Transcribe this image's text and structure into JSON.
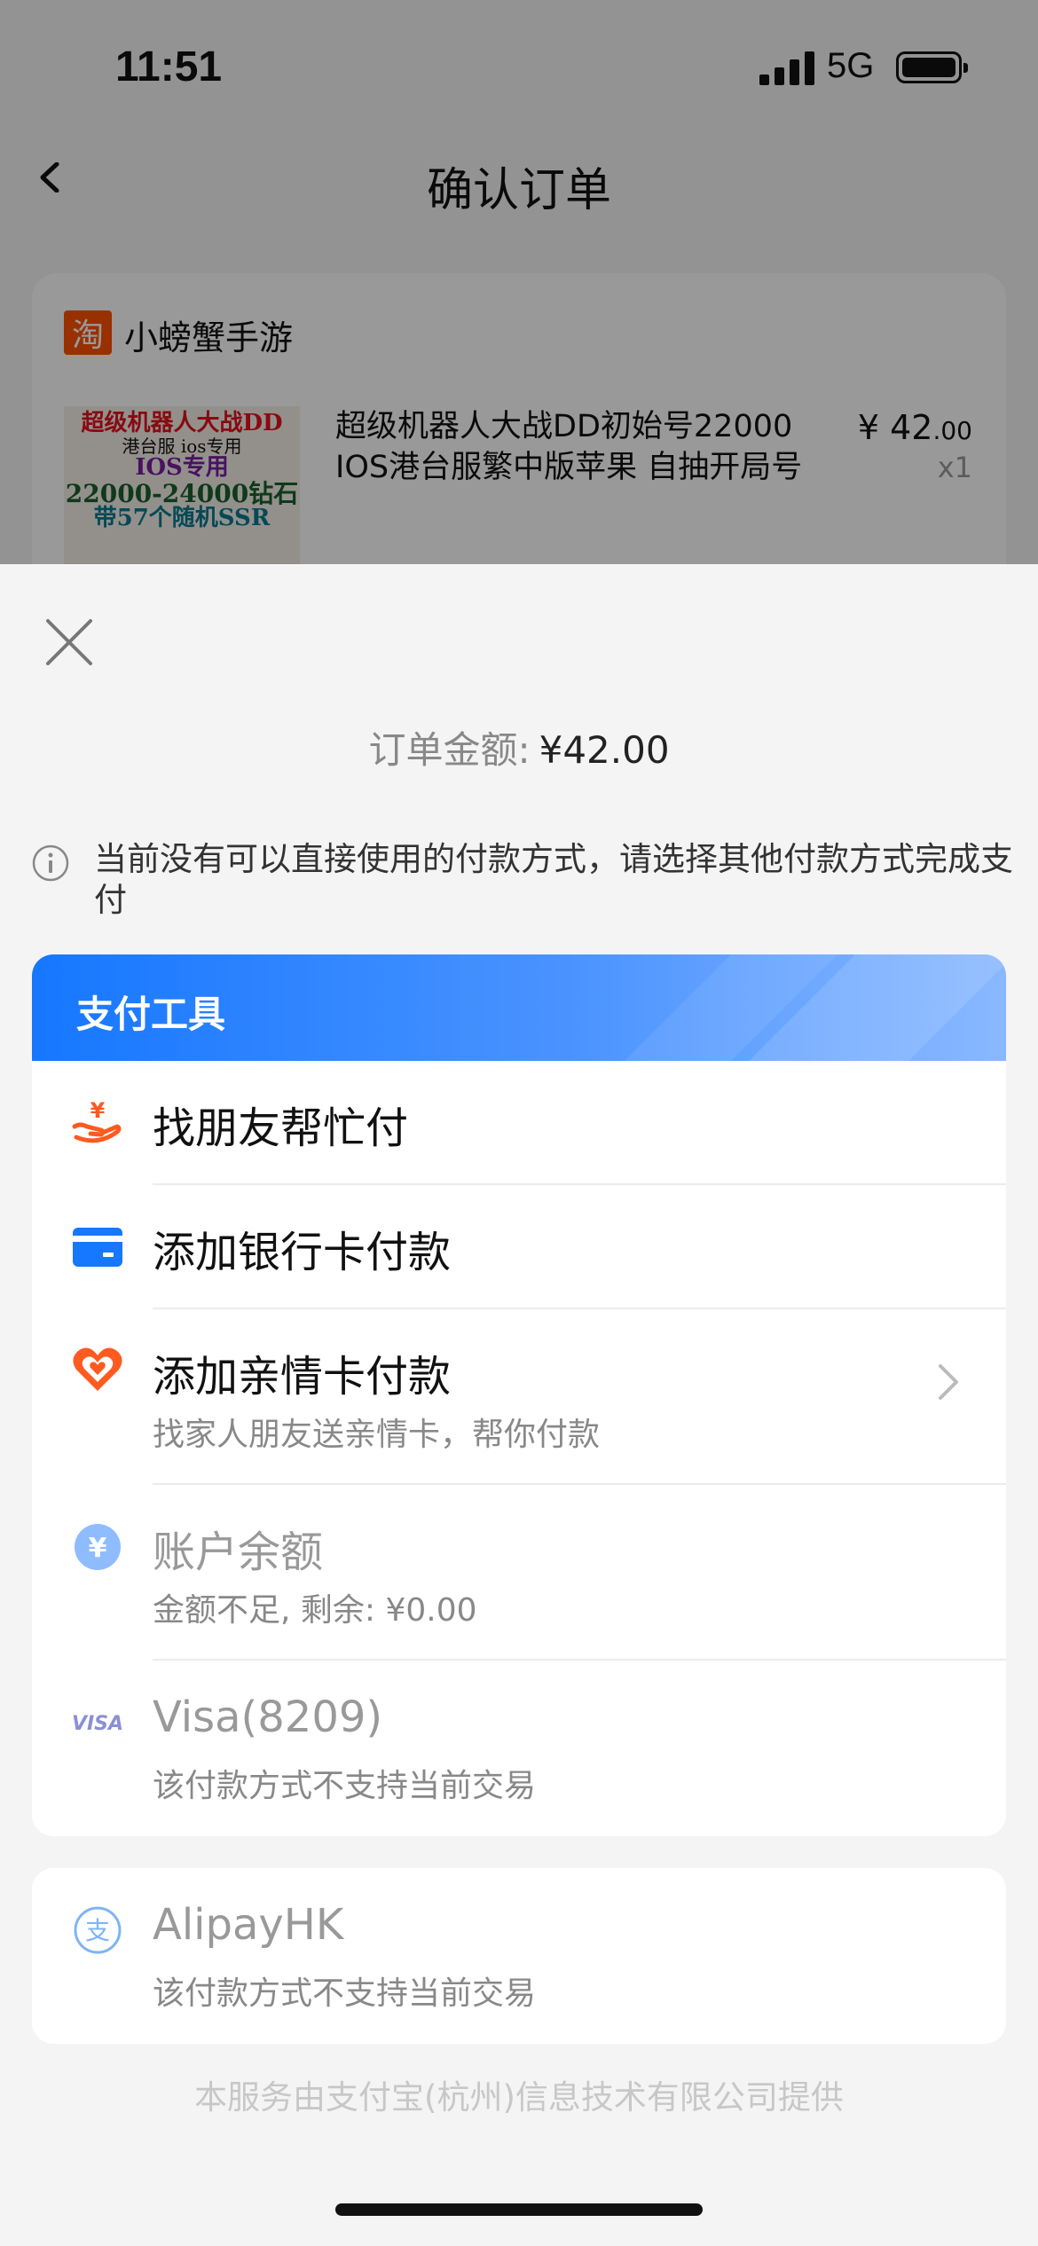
{
  "status_bar": {
    "time": "11:51",
    "network": "5G"
  },
  "nav": {
    "title": "确认订单"
  },
  "order": {
    "shop_logo": "淘",
    "shop_name": "小螃蟹手游",
    "product_image_text": [
      "超级机器人大战DD",
      "港台服 ios专用",
      "IOS专用",
      "22000-24000钻石",
      "带57个随机SSR"
    ],
    "product_title": "超级机器人大战DD初始号22000 IOS港台服繁中版苹果 自抽开局号",
    "price_symbol": "¥",
    "price_int": "42",
    "price_dec": ".00",
    "quantity": "x1"
  },
  "sheet": {
    "amount_label": "订单金额:",
    "amount_value": "¥42.00",
    "notice": "当前没有可以直接使用的付款方式，请选择其他付款方式完成支付",
    "tools_title": "支付工具",
    "methods": [
      {
        "title": "找朋友帮忙付",
        "icon": "hand-yuan-icon"
      },
      {
        "title": "添加银行卡付款",
        "icon": "bank-card-icon"
      },
      {
        "title": "添加亲情卡付款",
        "subtitle": "找家人朋友送亲情卡，帮你付款",
        "icon": "heart-card-icon"
      },
      {
        "title": "账户余额",
        "subtitle": "金额不足, 剩余: ¥0.00",
        "icon": "yuan-coin-icon"
      },
      {
        "title": "Visa(8209)",
        "subtitle": "该付款方式不支持当前交易",
        "icon": "visa-icon",
        "icon_text": "VISA"
      }
    ],
    "alipayhk": {
      "title": "AlipayHK",
      "subtitle": "该付款方式不支持当前交易",
      "icon": "alipay-icon",
      "icon_text": "支"
    },
    "footer": "本服务由支付宝(杭州)信息技术有限公司提供"
  },
  "colors": {
    "accent": "#1677ff",
    "orange": "#ff5a1f",
    "muted": "#888888"
  }
}
